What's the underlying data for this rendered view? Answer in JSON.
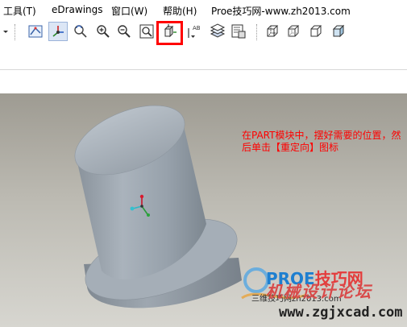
{
  "menubar": {
    "items": [
      {
        "label": "工具(T)"
      },
      {
        "label": "eDrawings"
      },
      {
        "label": "窗口(W)"
      },
      {
        "label": "帮助(H)"
      },
      {
        "label": "Proe技巧网-www.zh2013.com"
      }
    ]
  },
  "toolbar": {
    "buttons": [
      {
        "icon": "dropdown-arrow-icon"
      },
      {
        "icon": "model-view-icon"
      },
      {
        "icon": "coordinate-triad-icon"
      },
      {
        "icon": "rotate-icon"
      },
      {
        "icon": "zoom-in-icon"
      },
      {
        "icon": "zoom-out-icon"
      },
      {
        "icon": "zoom-fit-icon"
      },
      {
        "icon": "reorient-icon",
        "highlighted": true
      },
      {
        "icon": "saved-views-icon"
      },
      {
        "icon": "layers-icon"
      },
      {
        "icon": "view-manager-icon"
      },
      {
        "icon": "wireframe-icon"
      },
      {
        "icon": "hidden-line-icon"
      },
      {
        "icon": "no-hidden-icon"
      },
      {
        "icon": "shading-icon"
      }
    ]
  },
  "viewport": {
    "annotation": "在PART模块中，摆好需要的位置，然后单击【重定向】图标",
    "watermark": {
      "brand_en": "PROE",
      "brand_cn": "技巧网",
      "forum": "机械设计论坛",
      "small": "三维技巧网zh2013.com",
      "url": "www.zgjxcad.com"
    }
  },
  "colors": {
    "highlight": "#ff0000",
    "annotation_text": "#ff0000",
    "model_body": "#9aa4ad"
  }
}
